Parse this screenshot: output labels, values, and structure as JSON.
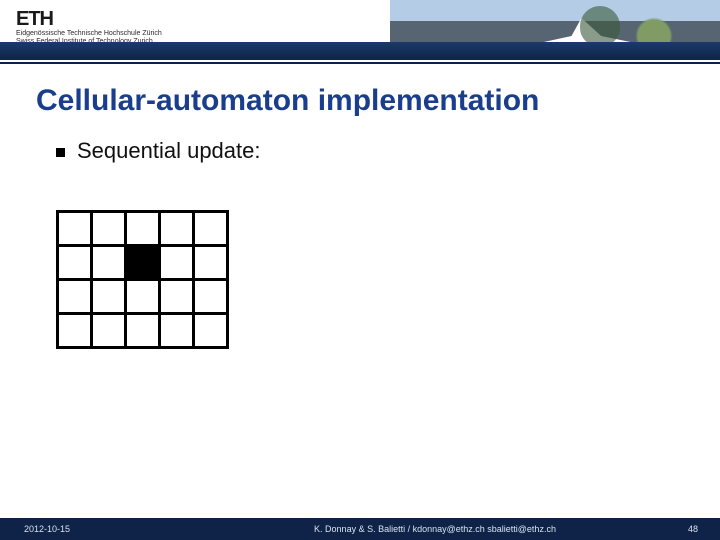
{
  "header": {
    "logo_text": "ETH",
    "institution_line1": "Eidgenössische Technische Hochschule Zürich",
    "institution_line2": "Swiss Federal Institute of Technology Zurich"
  },
  "title": "Cellular-automaton implementation",
  "bullet": {
    "text": "Sequential update:"
  },
  "grid": {
    "rows": 4,
    "cols": 5,
    "filled": [
      [
        1,
        2
      ]
    ]
  },
  "footer": {
    "date": "2012-10-15",
    "authors": "K. Donnay & S. Balietti / kdonnay@ethz.ch   sbalietti@ethz.ch",
    "page": "48"
  }
}
